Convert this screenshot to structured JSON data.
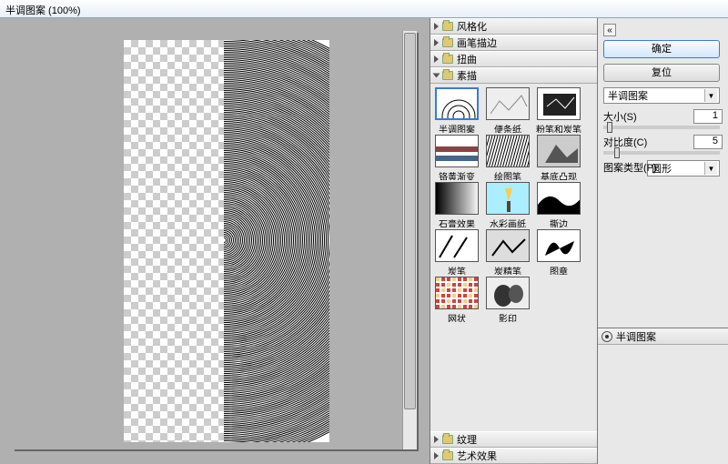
{
  "window": {
    "title": "半调图案 (100%)"
  },
  "categories": [
    {
      "label": "风格化",
      "open": false
    },
    {
      "label": "画笔描边",
      "open": false
    },
    {
      "label": "扭曲",
      "open": false
    },
    {
      "label": "素描",
      "open": true
    },
    {
      "label": "纹理",
      "open": false
    },
    {
      "label": "艺术效果",
      "open": false
    }
  ],
  "thumbs": [
    {
      "label": "半调图案",
      "sel": true
    },
    {
      "label": "便条纸"
    },
    {
      "label": "粉笔和炭笔"
    },
    {
      "label": "铬黄渐变"
    },
    {
      "label": "绘图笔"
    },
    {
      "label": "基底凸现"
    },
    {
      "label": "石膏效果"
    },
    {
      "label": "水彩画纸"
    },
    {
      "label": "撕边"
    },
    {
      "label": "炭笔"
    },
    {
      "label": "炭精笔"
    },
    {
      "label": "图章"
    },
    {
      "label": "网状"
    },
    {
      "label": "影印"
    }
  ],
  "sidebar": {
    "ok": "确定",
    "reset": "复位",
    "filter_name": "半调图案",
    "params": [
      {
        "label": "大小(S)",
        "value": "1",
        "pos": 4
      },
      {
        "label": "对比度(C)",
        "value": "5",
        "pos": 12
      }
    ],
    "pattern_label": "图案类型(P):",
    "pattern_value": "圆形"
  },
  "layers": {
    "title": "半调图案"
  }
}
